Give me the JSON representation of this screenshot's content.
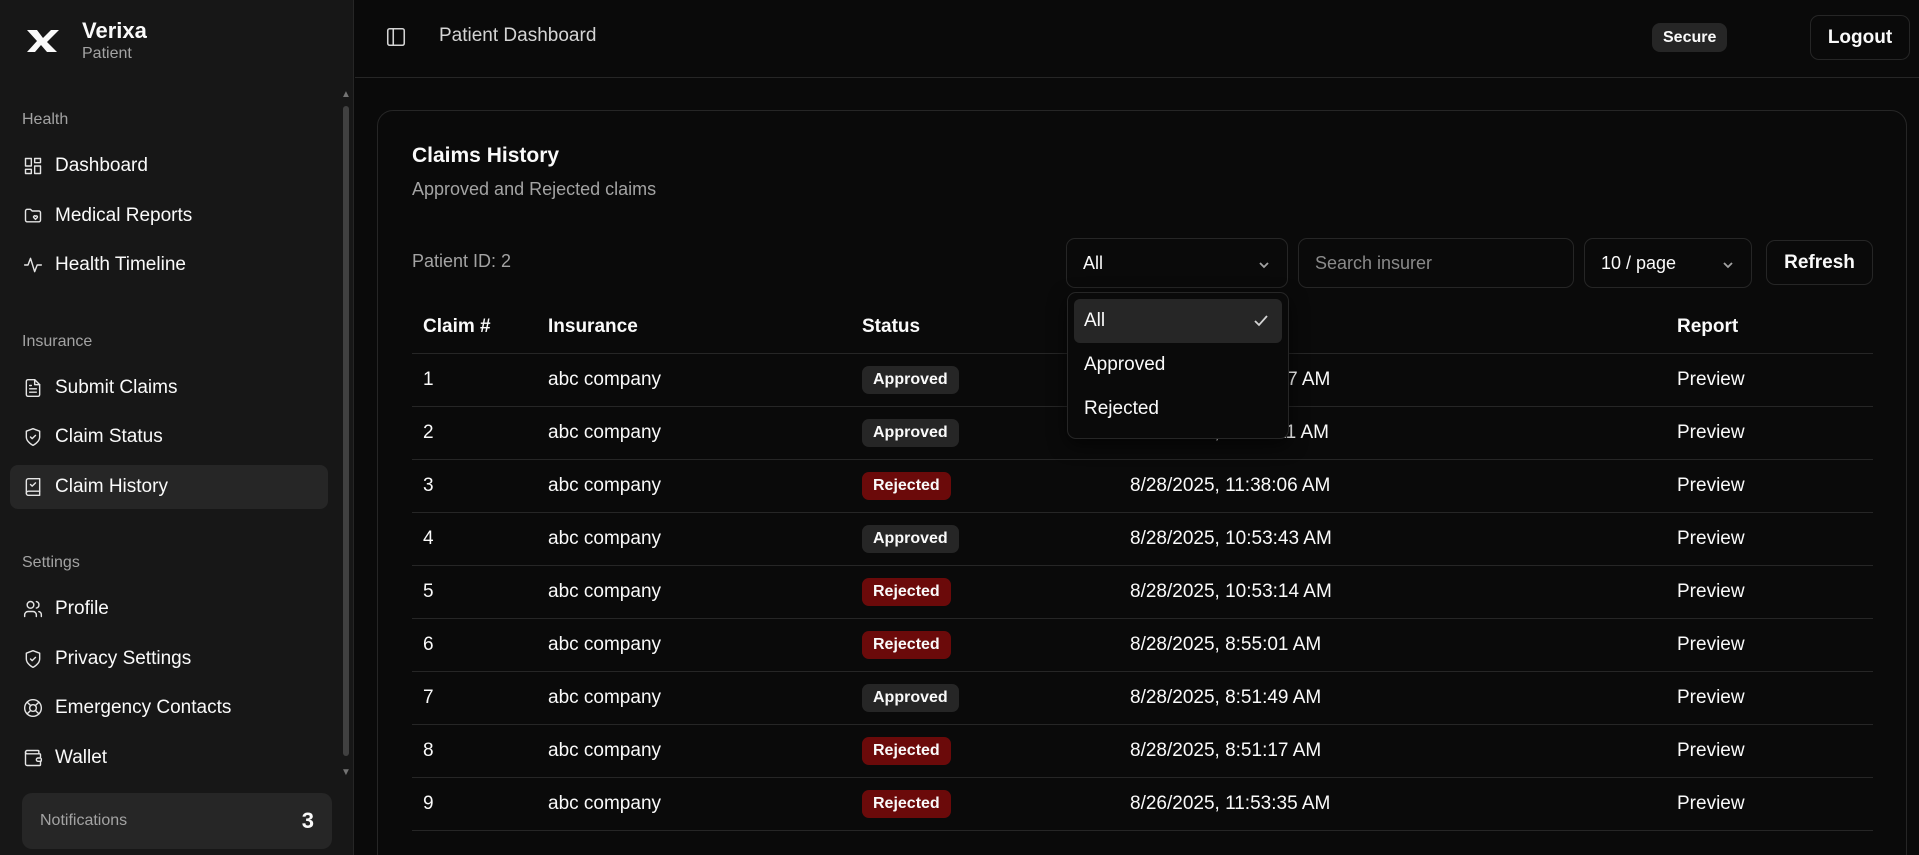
{
  "brand": {
    "name": "Verixa",
    "role": "Patient"
  },
  "sidebar": {
    "groups": [
      {
        "label": "Health",
        "items": [
          {
            "label": "Dashboard",
            "icon": "dashboard-icon"
          },
          {
            "label": "Medical Reports",
            "icon": "folder-heart-icon"
          },
          {
            "label": "Health Timeline",
            "icon": "activity-icon"
          }
        ]
      },
      {
        "label": "Insurance",
        "items": [
          {
            "label": "Submit Claims",
            "icon": "file-text-icon"
          },
          {
            "label": "Claim Status",
            "icon": "shield-check-icon"
          },
          {
            "label": "Claim History",
            "icon": "book-check-icon",
            "active": true
          }
        ]
      },
      {
        "label": "Settings",
        "items": [
          {
            "label": "Profile",
            "icon": "users-icon"
          },
          {
            "label": "Privacy Settings",
            "icon": "shield-check-icon"
          },
          {
            "label": "Emergency Contacts",
            "icon": "life-buoy-icon"
          },
          {
            "label": "Wallet",
            "icon": "wallet-icon"
          }
        ]
      }
    ],
    "notifications": {
      "label": "Notifications",
      "count": "3"
    }
  },
  "header": {
    "title": "Patient Dashboard",
    "secure_badge": "Secure",
    "logout_label": "Logout"
  },
  "claims": {
    "title": "Claims History",
    "subtitle": "Approved and Rejected claims",
    "patient_id": "Patient ID: 2",
    "status_filter": {
      "selected": "All",
      "options": [
        {
          "label": "All",
          "checked": true
        },
        {
          "label": "Approved"
        },
        {
          "label": "Rejected"
        }
      ]
    },
    "search_placeholder": "Search insurer",
    "page_size": "10 / page",
    "refresh_label": "Refresh",
    "columns": [
      "Claim #",
      "Insurance",
      "Status",
      "",
      "Report"
    ],
    "rows": [
      {
        "num": "1",
        "insurance": "abc company",
        "status": "Approved",
        "date": "8/30/2025, 11:42:17 AM",
        "report": "Preview"
      },
      {
        "num": "2",
        "insurance": "abc company",
        "status": "Approved",
        "date": "8/30/2025, 11:42:11 AM",
        "report": "Preview"
      },
      {
        "num": "3",
        "insurance": "abc company",
        "status": "Rejected",
        "date": "8/28/2025, 11:38:06 AM",
        "report": "Preview"
      },
      {
        "num": "4",
        "insurance": "abc company",
        "status": "Approved",
        "date": "8/28/2025, 10:53:43 AM",
        "report": "Preview"
      },
      {
        "num": "5",
        "insurance": "abc company",
        "status": "Rejected",
        "date": "8/28/2025, 10:53:14 AM",
        "report": "Preview"
      },
      {
        "num": "6",
        "insurance": "abc company",
        "status": "Rejected",
        "date": "8/28/2025, 8:55:01 AM",
        "report": "Preview"
      },
      {
        "num": "7",
        "insurance": "abc company",
        "status": "Approved",
        "date": "8/28/2025, 8:51:49 AM",
        "report": "Preview"
      },
      {
        "num": "8",
        "insurance": "abc company",
        "status": "Rejected",
        "date": "8/28/2025, 8:51:17 AM",
        "report": "Preview"
      },
      {
        "num": "9",
        "insurance": "abc company",
        "status": "Rejected",
        "date": "8/26/2025, 11:53:35 AM",
        "report": "Preview"
      }
    ]
  },
  "colors": {
    "background": "#0a0a0a",
    "sidebar": "#171717",
    "border": "#262626",
    "rejected_badge": "#6b0a0a",
    "approved_badge": "#262626"
  }
}
